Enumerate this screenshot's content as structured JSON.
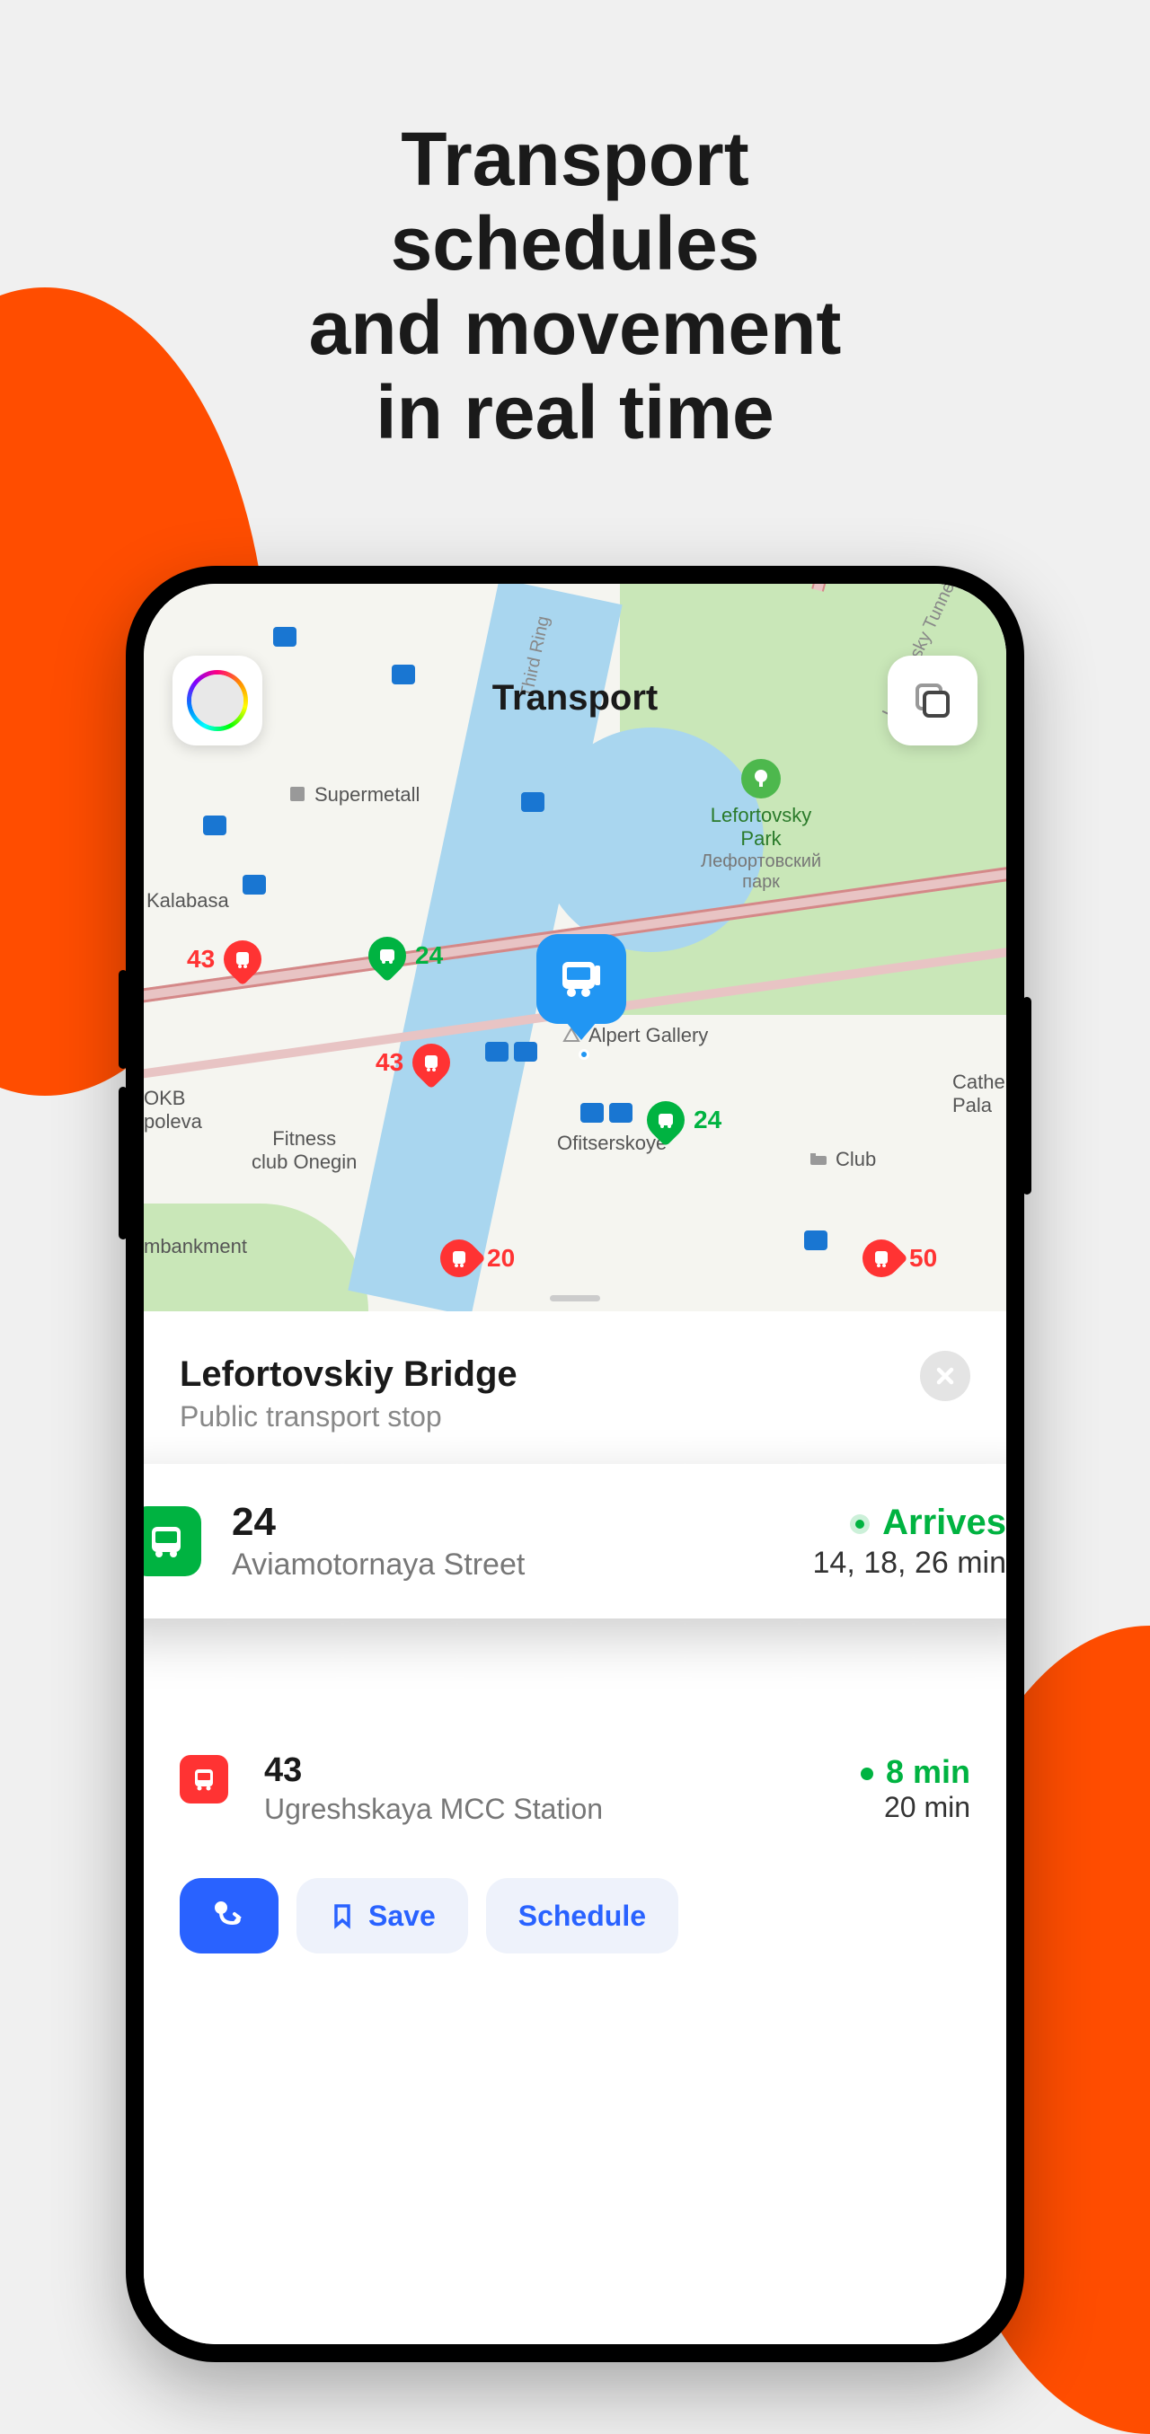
{
  "headline": "Transport schedules\nand movement\nin real time",
  "map": {
    "title": "Transport",
    "park": {
      "name": "Lefortovsky\nPark",
      "name_ru": "Лефортовский\nпарк"
    },
    "tunnel_label": "Lefortovsky Tunnel",
    "third_ring_label": "Third Ring",
    "pois": {
      "supermetall": "Supermetall",
      "kalabasa": "Kalabasa",
      "alpert": "Alpert Gallery",
      "ofitserskoye": "Ofitserskoye",
      "club": "Club",
      "okb": "OKB\npoleva",
      "fitness": "Fitness\nclub Onegin",
      "catherine": "Cathe\nPala",
      "embankment": "mbankment"
    },
    "markers": [
      {
        "num": "43",
        "color": "red"
      },
      {
        "num": "24",
        "color": "green"
      },
      {
        "num": "43",
        "color": "red"
      },
      {
        "num": "24",
        "color": "green"
      },
      {
        "num": "20",
        "color": "red"
      },
      {
        "num": "50",
        "color": "red"
      }
    ]
  },
  "stop": {
    "name": "Lefortovskiy Bridge",
    "subtitle": "Public transport stop"
  },
  "routes": [
    {
      "number": "24",
      "destination": "Aviamotornaya Street",
      "status": "Arrives",
      "times": "14, 18, 26 min",
      "color": "green"
    },
    {
      "number": "43",
      "destination": "Ugreshskaya MCC Station",
      "next": "8 min",
      "after": "20 min",
      "color": "red"
    }
  ],
  "actions": {
    "save": "Save",
    "schedule": "Schedule"
  }
}
